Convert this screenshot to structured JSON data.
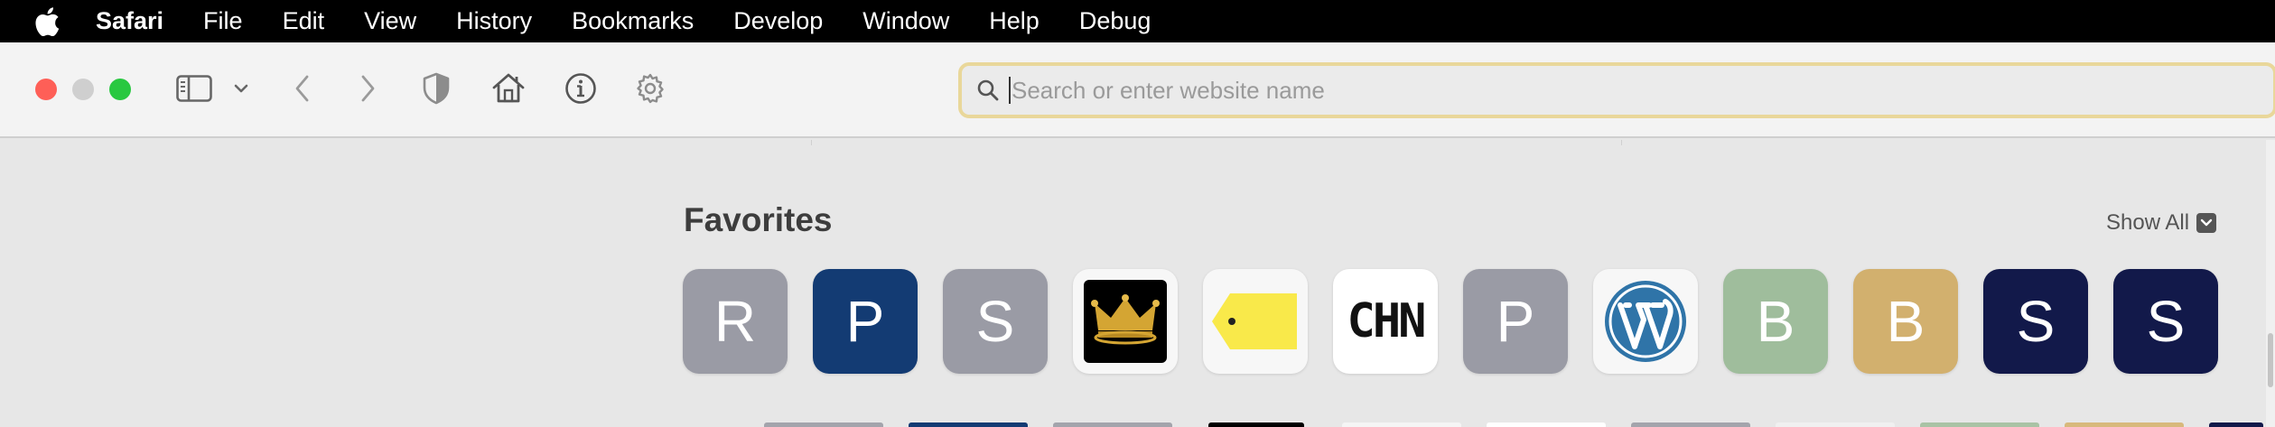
{
  "menubar": {
    "apple_icon": "apple-logo-icon",
    "app_name": "Safari",
    "items": [
      "File",
      "Edit",
      "View",
      "History",
      "Bookmarks",
      "Develop",
      "Window",
      "Help",
      "Debug"
    ]
  },
  "toolbar": {
    "traffic_lights": {
      "close": "#fe5f57",
      "minimize": "#cfcfcf",
      "zoom": "#28c840"
    },
    "icons": [
      "sidebar-icon",
      "chevron-down-icon",
      "back-icon",
      "forward-icon",
      "shield-icon",
      "home-icon",
      "info-icon",
      "gear-icon"
    ]
  },
  "address": {
    "placeholder": "Search or enter website name",
    "value": "",
    "border_color": "#e9d79a"
  },
  "favorites": {
    "title": "Favorites",
    "show_all": "Show All",
    "tiles": [
      {
        "letter": "R",
        "bg": "#9a9ba5"
      },
      {
        "letter": "P",
        "bg": "#133b73"
      },
      {
        "letter": "S",
        "bg": "#9a9ba5"
      },
      {
        "letter": "",
        "icon": "crown-icon",
        "bg": "#f7f7f7"
      },
      {
        "letter": "",
        "icon": "price-tag-icon",
        "bg": "#f7f7f7"
      },
      {
        "letter": "CHN",
        "icon": "chn-logo",
        "bg": "#ffffff"
      },
      {
        "letter": "P",
        "bg": "#9a9ba5"
      },
      {
        "letter": "",
        "icon": "wordpress-icon",
        "bg": "#f7f7f7"
      },
      {
        "letter": "B",
        "bg": "#9fbd9c"
      },
      {
        "letter": "B",
        "bg": "#d2b06e"
      },
      {
        "letter": "S",
        "bg": "#12194a"
      },
      {
        "letter": "S",
        "bg": "#12194a"
      }
    ]
  }
}
